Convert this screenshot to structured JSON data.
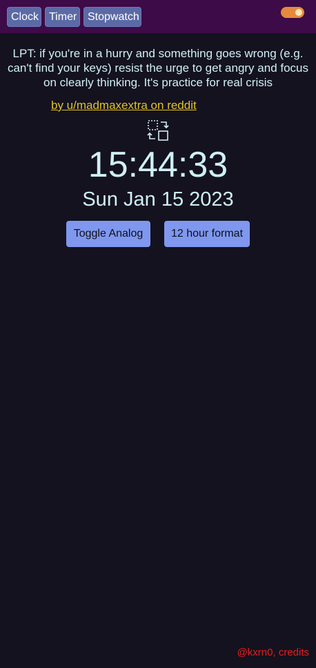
{
  "nav": {
    "tabs": [
      {
        "label": "Clock"
      },
      {
        "label": "Timer"
      },
      {
        "label": "Stopwatch"
      }
    ],
    "theme_toggle": {
      "state": "on",
      "icon": "toggle-switch"
    }
  },
  "quote": {
    "text": "LPT: if you're in a hurry and something goes wrong (e.g. can't find your keys) resist the urge to get angry and focus on clearly thinking. It's practice for real crisis",
    "author": "by u/madmaxextra on reddit"
  },
  "clock": {
    "swap_icon": "swap-view-icon",
    "time": "15:44:33",
    "date": "Sun Jan 15 2023"
  },
  "actions": {
    "toggle_analog": "Toggle Analog",
    "hour_format": "12 hour format"
  },
  "footer": {
    "credits": "@kxrn0, credits"
  },
  "colors": {
    "background": "#14121f",
    "topbar": "#3d0b47",
    "nav_button": "#5b6aa6",
    "toggle": "#e58a3c",
    "text": "#cfeff6",
    "link": "#e3c225",
    "action_button": "#7f97ee",
    "credits": "#e41e1e"
  }
}
